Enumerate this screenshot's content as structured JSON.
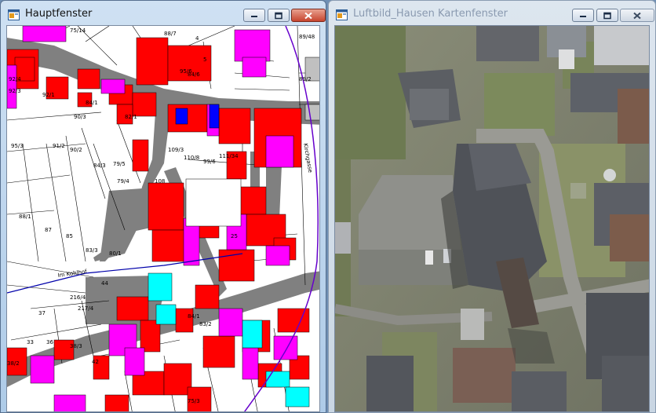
{
  "windows": [
    {
      "id": "main",
      "title": "Hauptfenster",
      "active": true,
      "content": "cadastral-map"
    },
    {
      "id": "aerial",
      "title": "Luftbild_Hausen Kartenfenster",
      "active": false,
      "content": "aerial-photo"
    }
  ],
  "map": {
    "parcel_labels": [
      "75/14",
      "88/7",
      "89/48",
      "89/2",
      "92/4",
      "92/3",
      "92/1",
      "95/6",
      "84/6",
      "84/1",
      "90/3",
      "82/1",
      "95/3",
      "91/2",
      "90/2",
      "84/3",
      "79/5",
      "79/4",
      "108",
      "109/3",
      "110/8",
      "99/6",
      "111/34",
      "88/1",
      "87",
      "85",
      "83/3",
      "80/1",
      "44",
      "216/4",
      "217/4",
      "37",
      "33",
      "36",
      "38/3",
      "42",
      "83/2",
      "84/1",
      "75/3",
      "38/2",
      "25",
      "4",
      "5"
    ],
    "street_labels": [
      "Im Kohlhof",
      "Kirchgasse"
    ],
    "colors": {
      "building_red": "#ff0000",
      "building_magenta": "#ff00ff",
      "building_blue": "#0000ff",
      "building_cyan": "#00ffff",
      "road_gray": "#808080",
      "background": "#ffffff",
      "boundary_violet": "#6600cc"
    }
  },
  "icons": {
    "app": "app-window-icon",
    "minimize": "minimize-icon",
    "maximize": "maximize-icon",
    "close": "close-icon"
  }
}
